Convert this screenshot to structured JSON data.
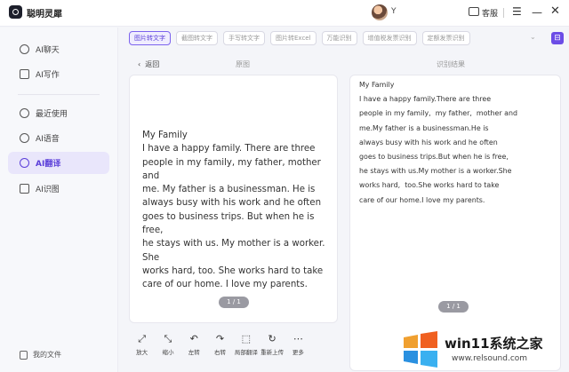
{
  "app": {
    "title": "聪明灵犀",
    "user_name": "Y",
    "service_label": "客服"
  },
  "sidebar": {
    "items": [
      {
        "label": "AI聊天",
        "icon": "chat-icon"
      },
      {
        "label": "AI写作",
        "icon": "edit-icon"
      },
      {
        "label": "最近使用",
        "icon": "history-icon"
      },
      {
        "label": "AI语音",
        "icon": "audio-icon"
      },
      {
        "label": "AI翻译",
        "icon": "translate-icon",
        "active": true
      },
      {
        "label": "AI识图",
        "icon": "image-recognition-icon"
      }
    ],
    "bottom_label": "我的文件"
  },
  "tabs": [
    "图片转文字",
    "截图转文字",
    "手写转文字",
    "图片转Excel",
    "万能识别",
    "增值税发票识别",
    "定额发票识别"
  ],
  "main": {
    "back_label": "返回",
    "original_header": "原图",
    "result_header": "识别结果",
    "original_text": "My Family\nI have a happy family. There are three\npeople in my family, my father, mother and\nme. My father is a businessman. He is\nalways busy with his work and he often\ngoes to business trips. But when he is free,\nhe stays with us. My mother is a worker. She\nworks hard, too. She works hard to take\ncare of our home. I love my parents.",
    "result_text": "My Family\nI have a happy family.There are three\npeople in my family,  my father,  mother and\nme.My father is a businessman.He is\nalways busy with his work and he often\ngoes to business trips.But when he is free,\nhe stays with us.My mother is a worker.She\nworks hard,  too.She works hard to take\ncare of our home.I love my parents.",
    "original_page": "1 / 1",
    "result_page": "1 / 1"
  },
  "toolbar": [
    {
      "label": "放大",
      "icon": "zoom-in-icon",
      "glyph": "⤢"
    },
    {
      "label": "缩小",
      "icon": "zoom-out-icon",
      "glyph": "⤡"
    },
    {
      "label": "左转",
      "icon": "rotate-left-icon",
      "glyph": "↶"
    },
    {
      "label": "右转",
      "icon": "rotate-right-icon",
      "glyph": "↷"
    },
    {
      "label": "局部翻译",
      "icon": "partial-translate-icon",
      "glyph": "⬚"
    },
    {
      "label": "重新上传",
      "icon": "reupload-icon",
      "glyph": "↻"
    },
    {
      "label": "更多",
      "icon": "more-icon",
      "glyph": "⋯"
    }
  ],
  "watermark": {
    "main": "win11系统之家",
    "sub": "www.relsound.com"
  },
  "colors": {
    "accent": "#5b3fd9",
    "active_bg": "#e9e6fb"
  }
}
